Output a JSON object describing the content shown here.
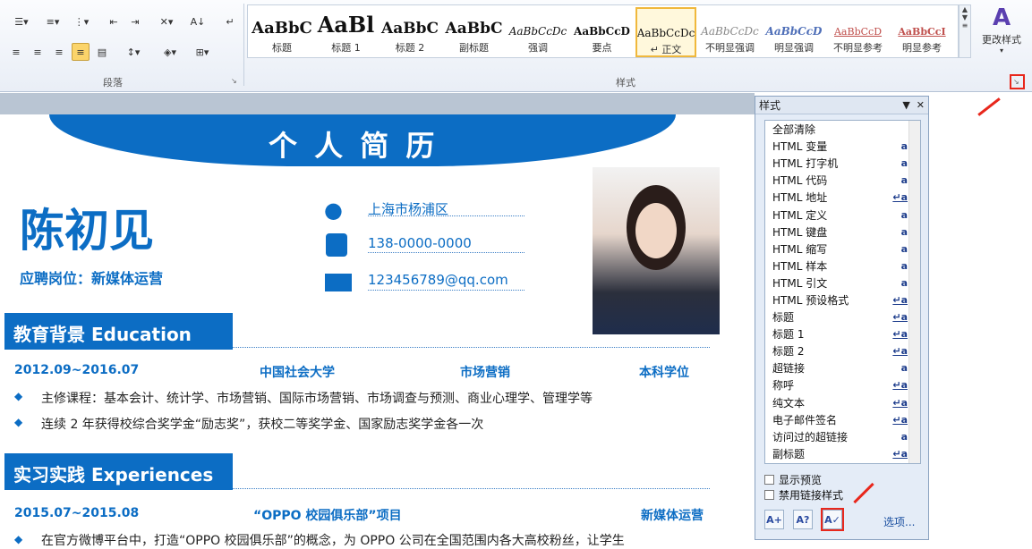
{
  "ribbon": {
    "paragraph_group_label": "段落",
    "styles_group_label": "样式",
    "change_styles_label": "更改样式",
    "gallery": [
      {
        "preview": "AaBbC",
        "name": "标题"
      },
      {
        "preview": "AaBl",
        "name": "标题 1"
      },
      {
        "preview": "AaBbC",
        "name": "标题 2"
      },
      {
        "preview": "AaBbC",
        "name": "副标题"
      },
      {
        "preview": "AaBbCcDc",
        "name": "强调"
      },
      {
        "preview": "AaBbCcD",
        "name": "要点"
      },
      {
        "preview": "AaBbCcDc",
        "name": "↵ 正文"
      },
      {
        "preview": "AaBbCcDc",
        "name": "不明显强调"
      },
      {
        "preview": "AaBbCcD",
        "name": "明显强调"
      },
      {
        "preview": "AaBbCcD",
        "name": "不明显参考"
      },
      {
        "preview": "AaBbCcI",
        "name": "明显参考"
      }
    ]
  },
  "resume": {
    "title": "个 人 简 历",
    "name": "陈初见",
    "position": "应聘岗位：新媒体运营",
    "location": "上海市杨浦区",
    "phone": "138-0000-0000",
    "email": "123456789@qq.com",
    "edu_heading": "教育背景 Education",
    "edu_period": "2012.09~2016.07",
    "edu_school": "中国社会大学",
    "edu_major": "市场营销",
    "edu_degree": "本科学位",
    "edu_b1": "主修课程：基本会计、统计学、市场营销、国际市场营销、市场调查与预测、商业心理学、管理学等",
    "edu_b2": "连续 2 年获得校综合奖学金“励志奖”，获校二等奖学金、国家励志奖学金各一次",
    "exp_heading": "实习实践 Experiences",
    "exp_period": "2015.07~2015.08",
    "exp_org": "“OPPO 校园俱乐部”项目",
    "exp_role": "新媒体运营",
    "exp_b1": "在官方微博平台中，打造“OPPO 校园俱乐部”的概念，为 OPPO 公司在全国范围内各大高校粉丝，让学生"
  },
  "pane": {
    "title": "样式",
    "items": [
      {
        "label": "全部清除",
        "glyph": ""
      },
      {
        "label": "HTML 变量",
        "glyph": "a"
      },
      {
        "label": "HTML 打字机",
        "glyph": "a"
      },
      {
        "label": "HTML 代码",
        "glyph": "a"
      },
      {
        "label": "HTML 地址",
        "glyph": "↵a"
      },
      {
        "label": "HTML 定义",
        "glyph": "a"
      },
      {
        "label": "HTML 键盘",
        "glyph": "a"
      },
      {
        "label": "HTML 缩写",
        "glyph": "a"
      },
      {
        "label": "HTML 样本",
        "glyph": "a"
      },
      {
        "label": "HTML 引文",
        "glyph": "a"
      },
      {
        "label": "HTML 预设格式",
        "glyph": "↵a"
      },
      {
        "label": "标题",
        "glyph": "↵a"
      },
      {
        "label": "标题 1",
        "glyph": "↵a"
      },
      {
        "label": "标题 2",
        "glyph": "↵a"
      },
      {
        "label": "超链接",
        "glyph": "a"
      },
      {
        "label": "称呼",
        "glyph": "↵a"
      },
      {
        "label": "纯文本",
        "glyph": "↵a"
      },
      {
        "label": "电子邮件签名",
        "glyph": "↵a"
      },
      {
        "label": "访问过的超链接",
        "glyph": "a"
      },
      {
        "label": "副标题",
        "glyph": "↵a"
      }
    ],
    "show_preview": "显示预览",
    "disable_linked": "禁用链接样式",
    "options": "选项..."
  }
}
